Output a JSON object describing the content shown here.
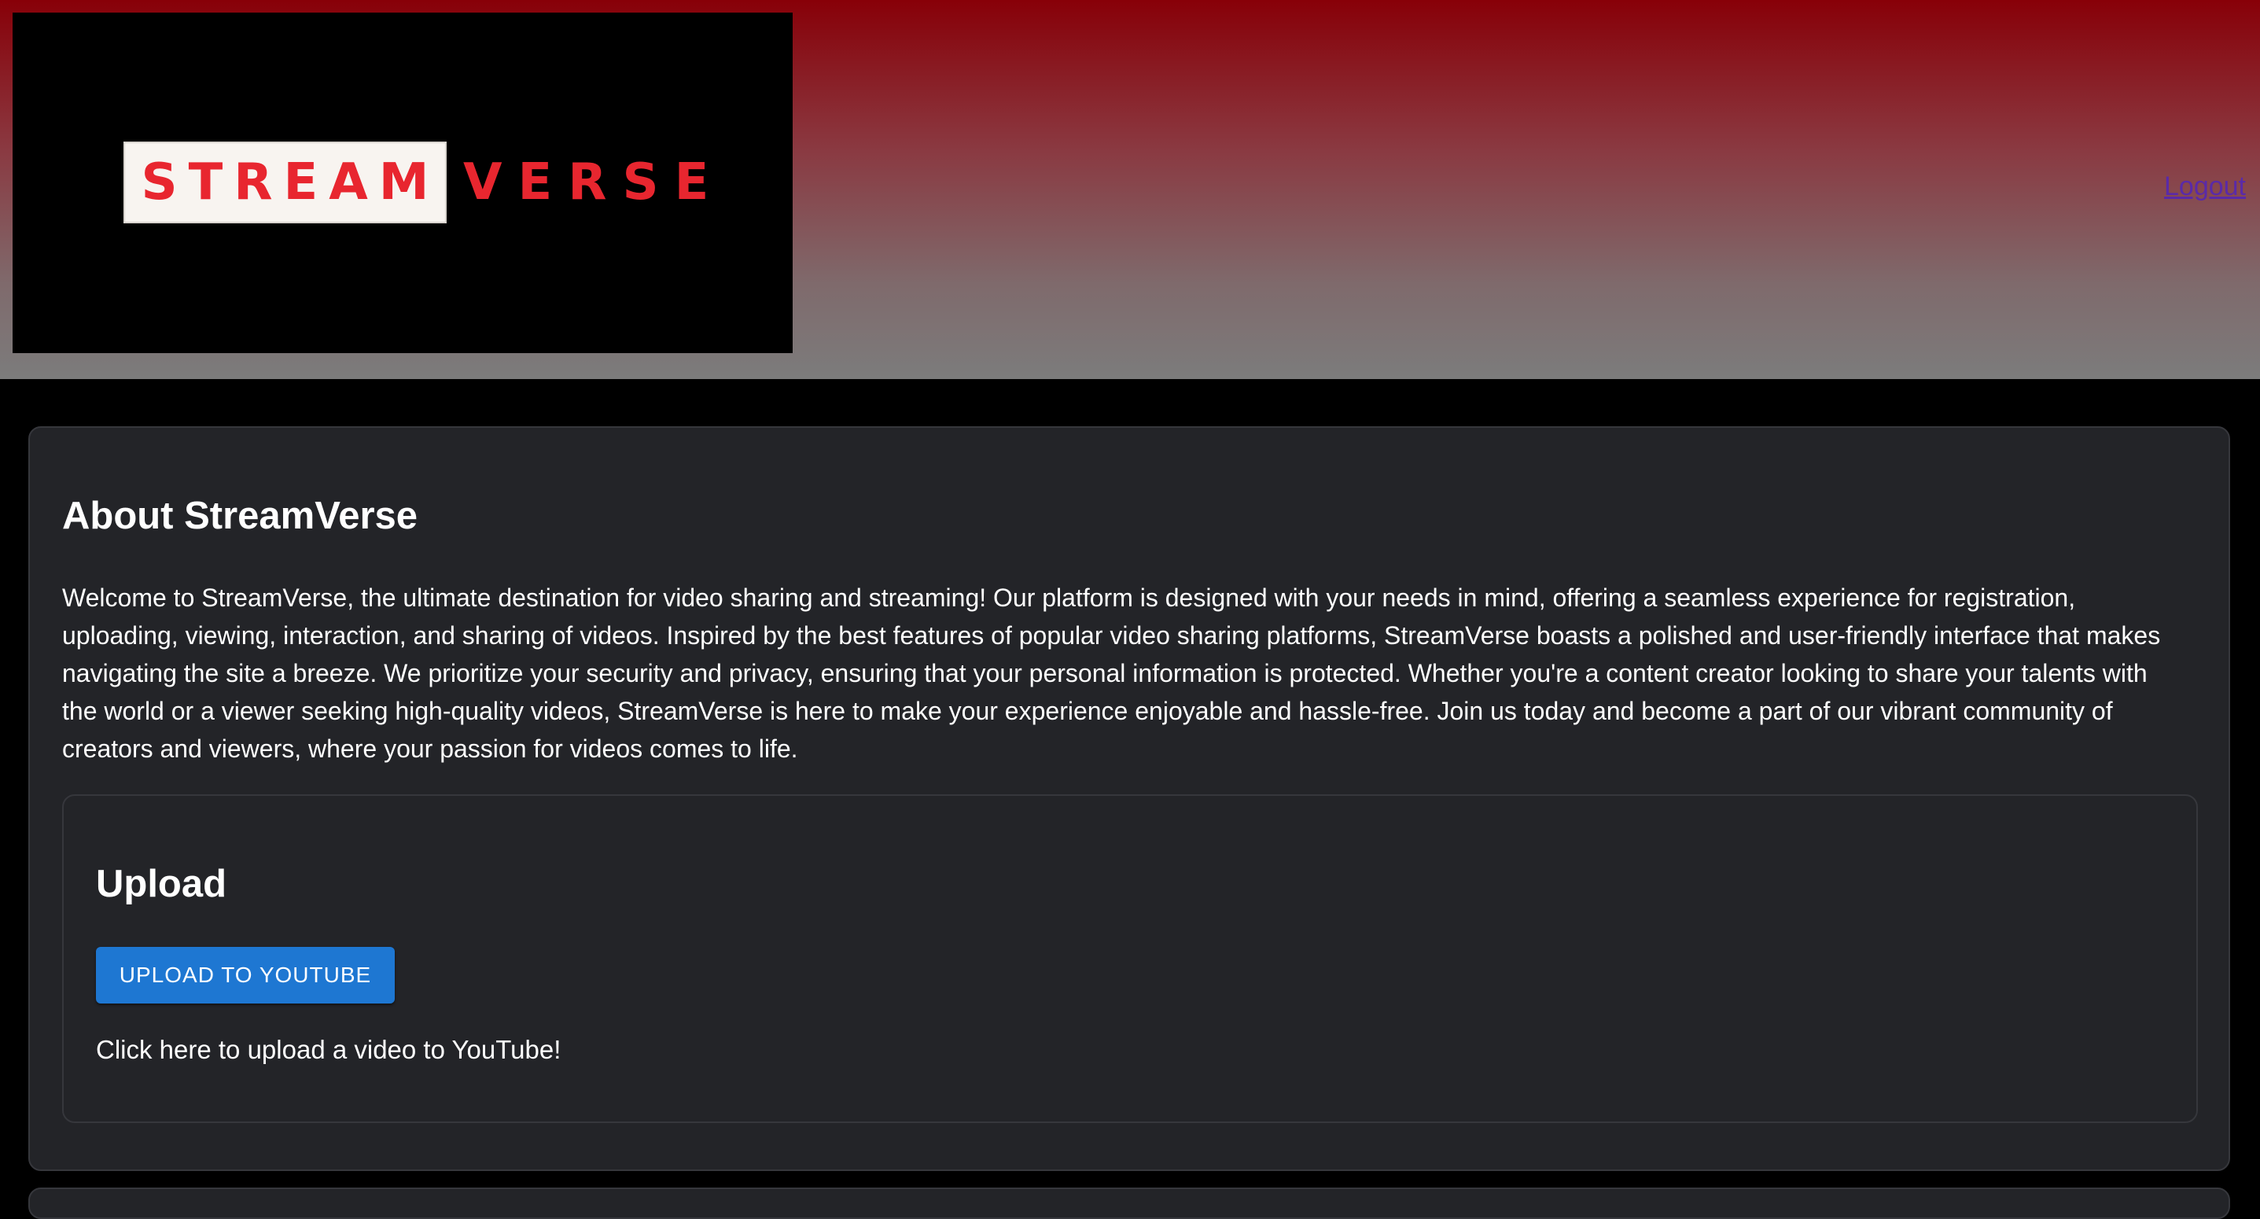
{
  "header": {
    "logo": {
      "word_left": "STREAM",
      "word_right": "VERSE",
      "accent_color": "#e8262f"
    },
    "logout_label": "Logout"
  },
  "about": {
    "title": "About StreamVerse",
    "body": "Welcome to StreamVerse, the ultimate destination for video sharing and streaming! Our platform is designed with your needs in mind, offering a seamless experience for registration, uploading, viewing, interaction, and sharing of videos. Inspired by the best features of popular video sharing platforms, StreamVerse boasts a polished and user-friendly interface that makes navigating the site a breeze. We prioritize your security and privacy, ensuring that your personal information is protected. Whether you're a content creator looking to share your talents with the world or a viewer seeking high-quality videos, StreamVerse is here to make your experience enjoyable and hassle-free. Join us today and become a part of our vibrant community of creators and viewers, where your passion for videos comes to life."
  },
  "upload": {
    "title": "Upload",
    "button_label": "UPLOAD TO YOUTUBE",
    "caption": "Click here to upload a video to YouTube!",
    "button_color": "#1e77d2"
  },
  "colors": {
    "header_top": "#880008",
    "header_bottom": "#7c7c7c",
    "page_background": "#000000",
    "card_background": "#232428"
  }
}
